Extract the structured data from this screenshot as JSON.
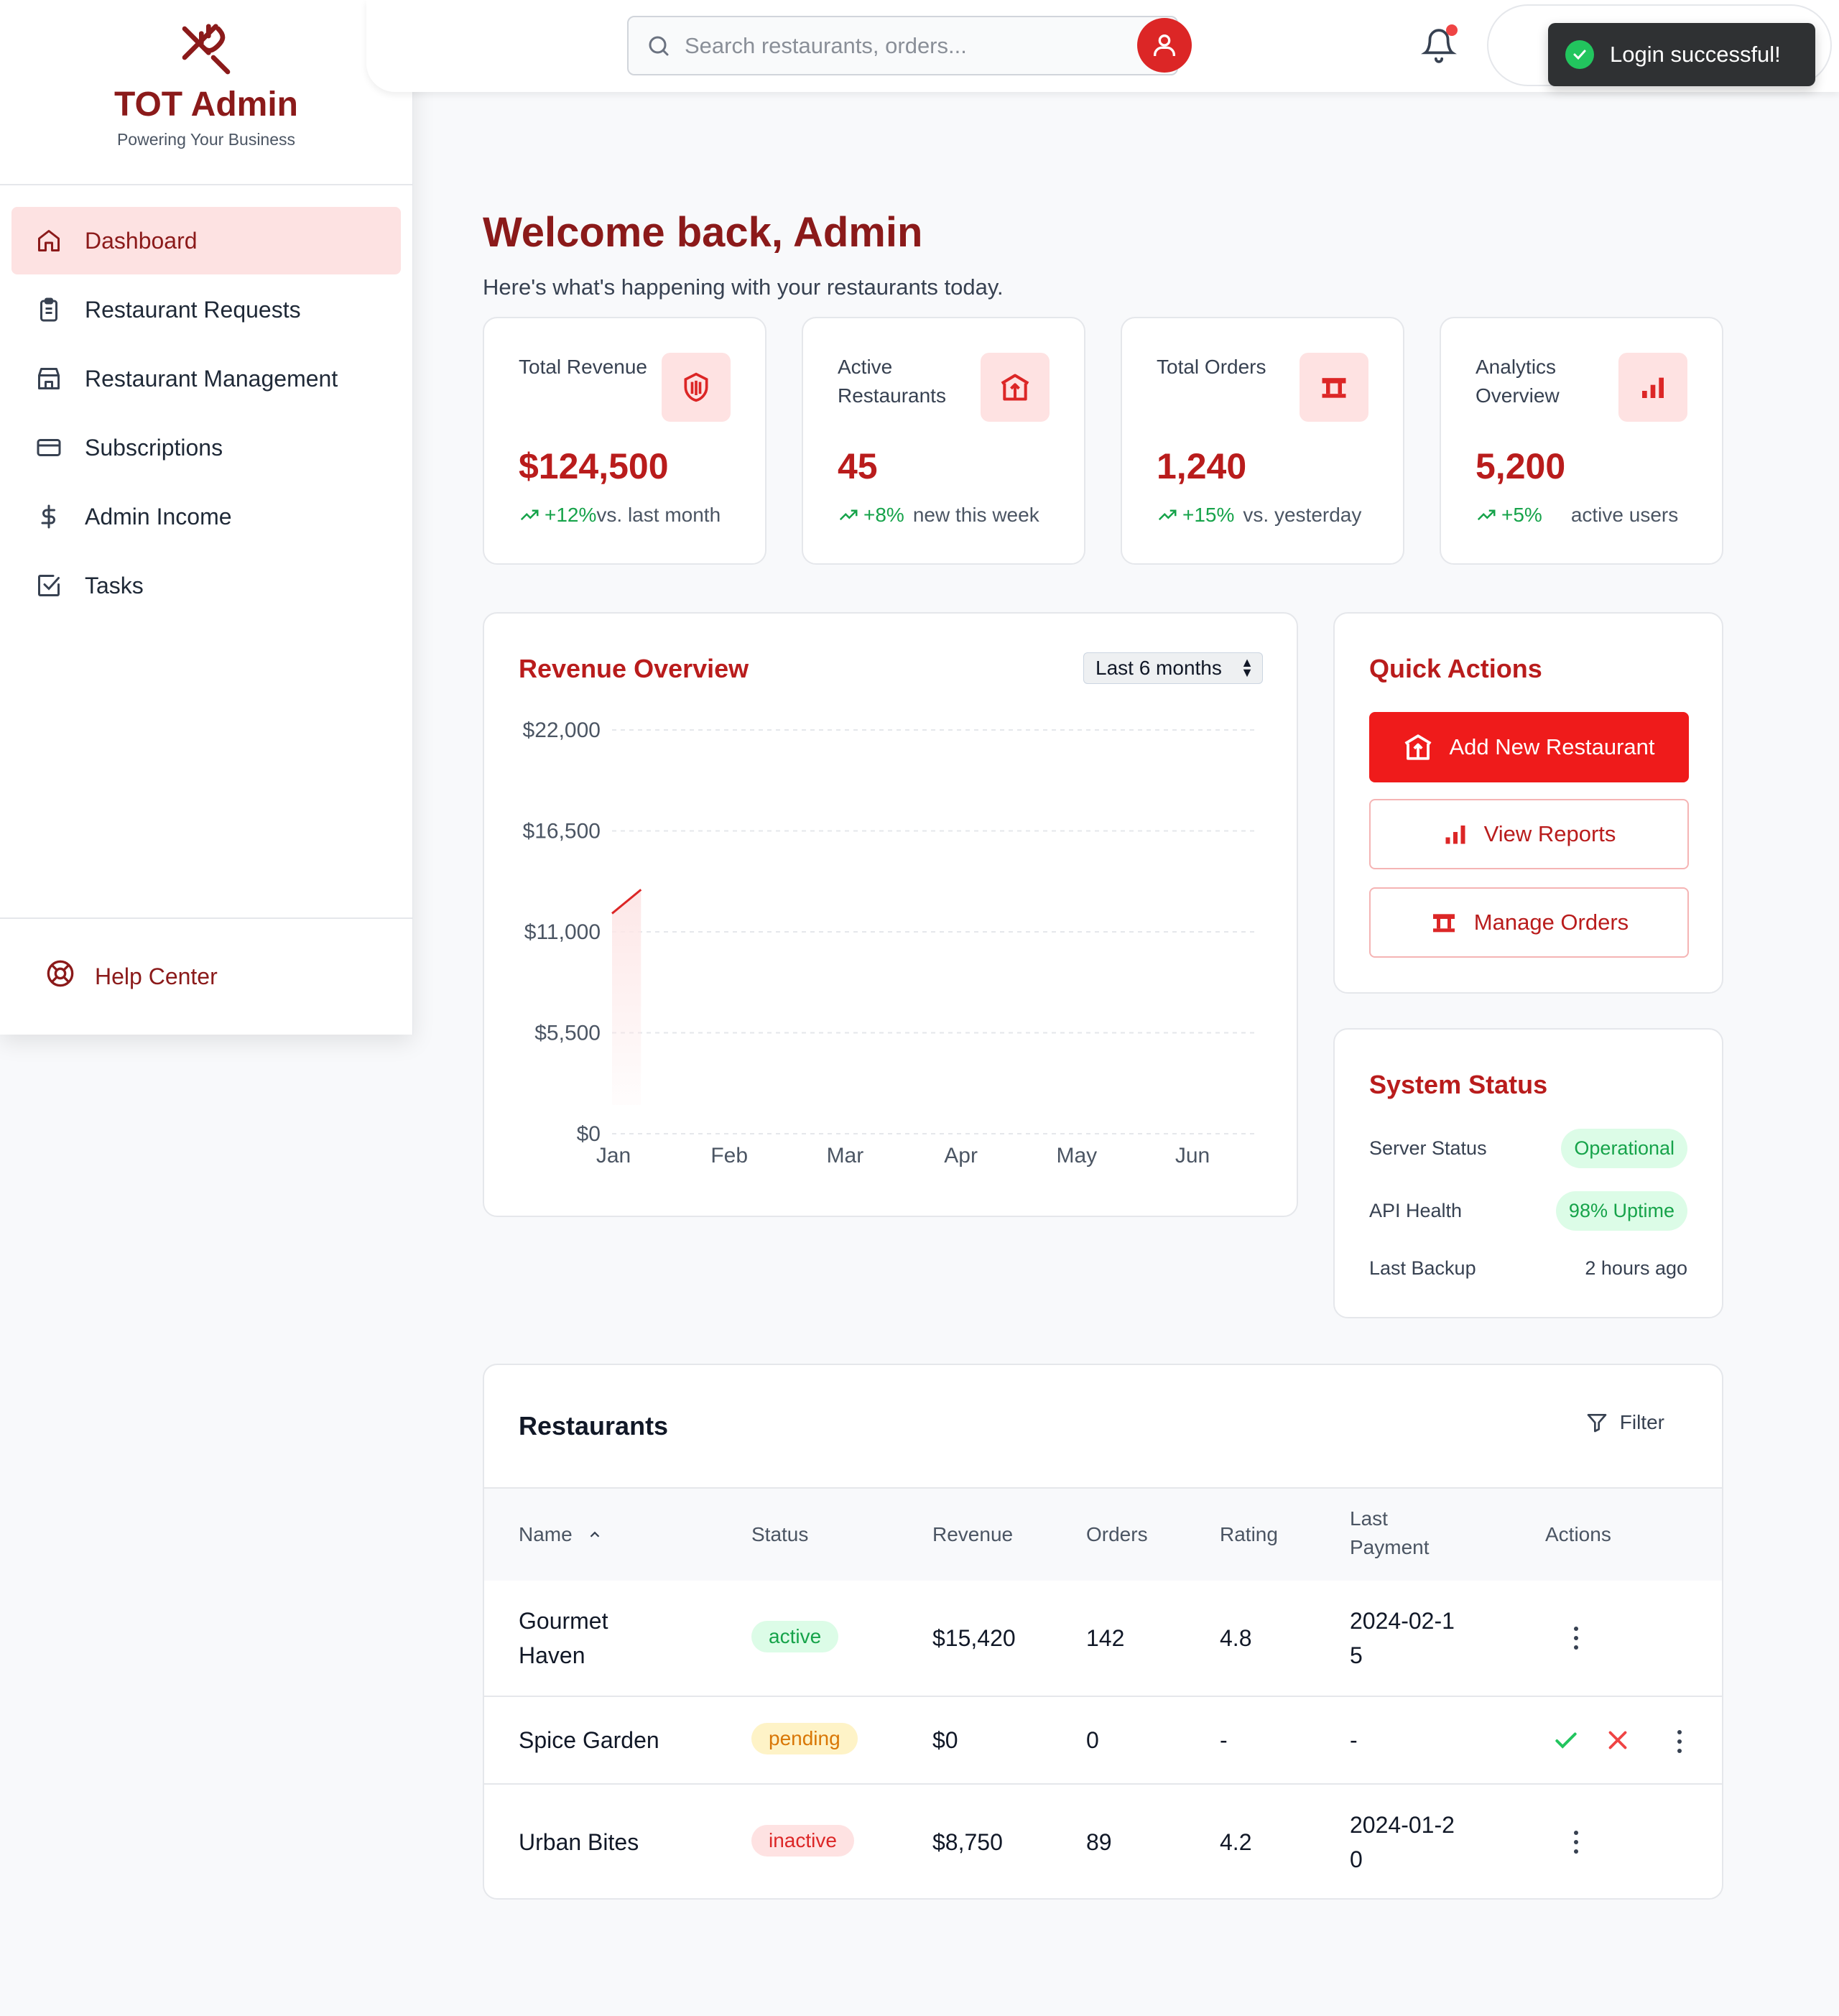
{
  "brand": {
    "title": "TOT Admin",
    "subtitle": "Powering Your Business"
  },
  "nav": [
    {
      "label": "Dashboard",
      "icon": "home-icon",
      "active": true
    },
    {
      "label": "Restaurant Requests",
      "icon": "clipboard-icon"
    },
    {
      "label": "Restaurant Management",
      "icon": "store-icon"
    },
    {
      "label": "Subscriptions",
      "icon": "credit-card-icon"
    },
    {
      "label": "Admin Income",
      "icon": "dollar-icon"
    },
    {
      "label": "Tasks",
      "icon": "checkbox-icon"
    }
  ],
  "help": {
    "label": "Help Center",
    "icon": "lifebuoy-icon"
  },
  "search": {
    "placeholder": "Search restaurants, orders..."
  },
  "toast": {
    "message": "Login successful!"
  },
  "header": {
    "title": "Welcome back, Admin",
    "subtitle": "Here's what's happening with your restaurants today."
  },
  "stats": [
    {
      "label": "Total Revenue",
      "value": "$124,500",
      "change": "+12%",
      "desc": "vs. last month",
      "icon": "shield-icon"
    },
    {
      "label": "Active Restaurants",
      "value": "45",
      "change": "+8%",
      "desc": "new this week",
      "icon": "restaurant-icon"
    },
    {
      "label": "Total Orders",
      "value": "1,240",
      "change": "+15%",
      "desc": "vs. yesterday",
      "icon": "table-icon"
    },
    {
      "label": "Analytics Overview",
      "value": "5,200",
      "change": "+5%",
      "desc": "active users",
      "icon": "bar-chart-icon"
    }
  ],
  "revenue": {
    "title": "Revenue Overview",
    "range": "Last 6 months"
  },
  "chart_data": {
    "type": "area",
    "title": "Revenue Overview",
    "categories": [
      "Jan",
      "Feb",
      "Mar",
      "Apr",
      "May",
      "Jun"
    ],
    "x_ticks": [
      "Jan",
      "Feb",
      "Mar",
      "Apr",
      "May",
      "Jun"
    ],
    "y_ticks": [
      "$0",
      "$5,500",
      "$11,000",
      "$16,500",
      "$22,000"
    ],
    "series": [
      {
        "values": [
          12000,
          13300
        ]
      }
    ],
    "x_partial": [
      0,
      0.25
    ],
    "ylim": [
      0,
      22000
    ],
    "grid": true,
    "colors": {
      "line": "#dc2626",
      "fill": "#fde7e7"
    }
  },
  "quick_actions": {
    "title": "Quick Actions",
    "buttons": [
      {
        "label": "Add New Restaurant",
        "icon": "restaurant-icon"
      },
      {
        "label": "View Reports",
        "icon": "bar-chart-icon"
      },
      {
        "label": "Manage Orders",
        "icon": "table-icon"
      }
    ]
  },
  "system_status": {
    "title": "System Status",
    "rows": [
      {
        "label": "Server Status",
        "value": "Operational"
      },
      {
        "label": "API Health",
        "value": "98% Uptime"
      },
      {
        "label": "Last Backup",
        "value": "2 hours ago"
      }
    ]
  },
  "table": {
    "title": "Restaurants",
    "filter_label": "Filter",
    "columns": [
      "Name",
      "Status",
      "Revenue",
      "Orders",
      "Rating",
      "Last Payment",
      "Actions"
    ],
    "rows": [
      {
        "name": "Gourmet Haven",
        "status": "active",
        "revenue": "$15,420",
        "orders": "142",
        "rating": "4.8",
        "last_payment": "2024-02-15"
      },
      {
        "name": "Spice Garden",
        "status": "pending",
        "revenue": "$0",
        "orders": "0",
        "rating": "-",
        "last_payment": "-"
      },
      {
        "name": "Urban Bites",
        "status": "inactive",
        "revenue": "$8,750",
        "orders": "89",
        "rating": "4.2",
        "last_payment": "2024-01-20"
      }
    ]
  },
  "colors": {
    "brand": "#8b1a1a",
    "accent": "#ef1b1b",
    "success": "#16a34a",
    "warning": "#d97706"
  }
}
